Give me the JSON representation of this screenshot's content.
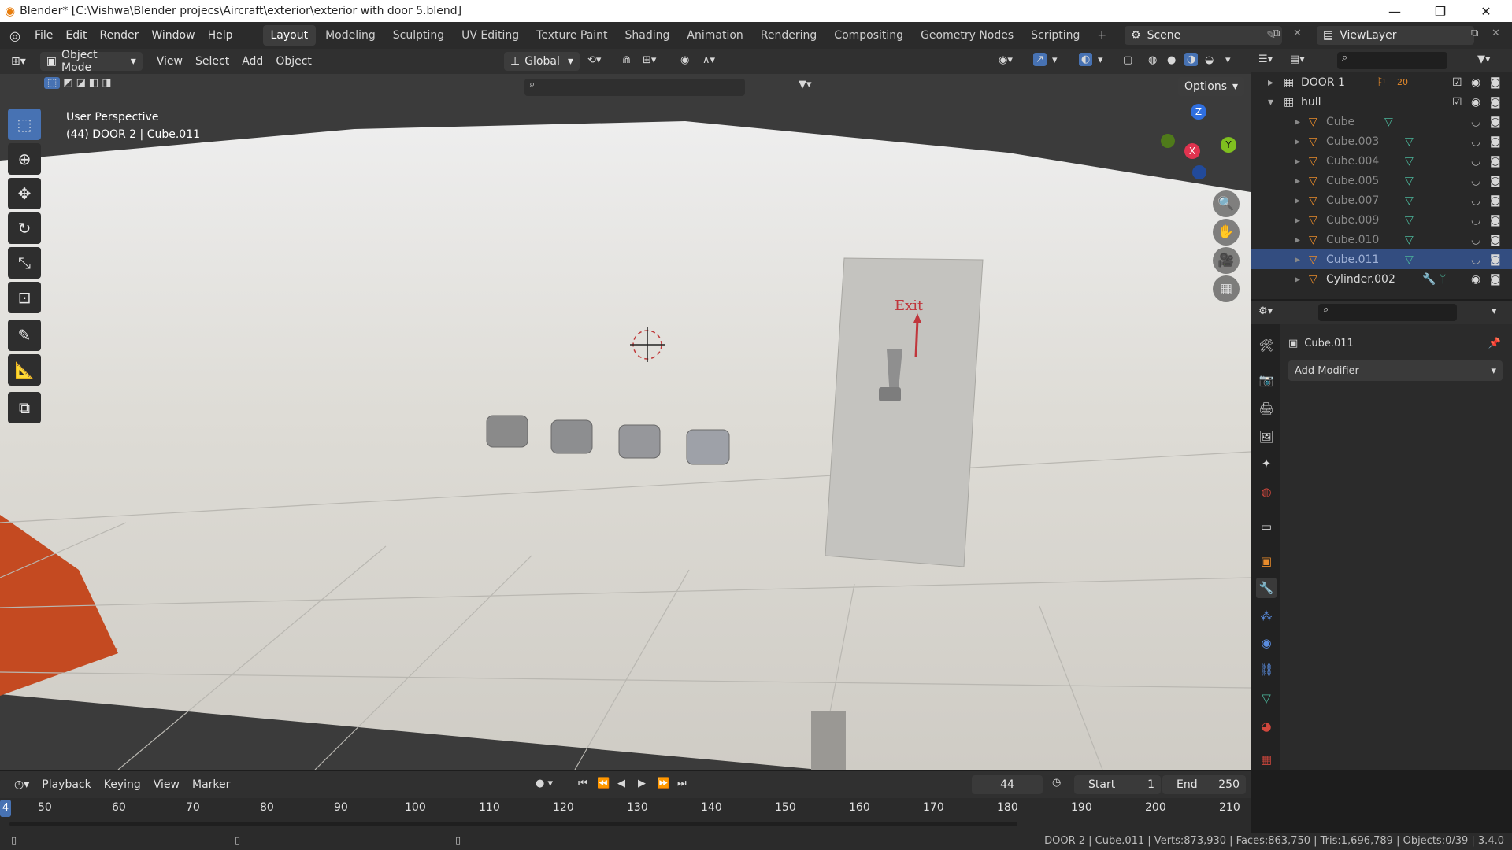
{
  "window": {
    "title": "Blender* [C:\\Vishwa\\Blender projecs\\Aircraft\\exterior\\exterior with door 5.blend]",
    "minimize": "—",
    "maximize": "❐",
    "close": "✕"
  },
  "menus": [
    "File",
    "Edit",
    "Render",
    "Window",
    "Help"
  ],
  "workspaces": [
    "Layout",
    "Modeling",
    "Sculpting",
    "UV Editing",
    "Texture Paint",
    "Shading",
    "Animation",
    "Rendering",
    "Compositing",
    "Geometry Nodes",
    "Scripting"
  ],
  "active_workspace": "Layout",
  "scene": {
    "name": "Scene",
    "view_layer": "ViewLayer"
  },
  "viewport_header": {
    "mode": "Object Mode",
    "menus": [
      "View",
      "Select",
      "Add",
      "Object"
    ],
    "orientation": "Global",
    "options": "Options"
  },
  "viewport": {
    "perspective": "User Perspective",
    "context": "(44) DOOR 2 | Cube.011",
    "door_sign": "Exit",
    "gizmo": {
      "z": "Z",
      "x": "X",
      "y": "Y"
    },
    "colors": {
      "fuselage": "#d9d7d1",
      "ground": "#3b3b3b",
      "accent": "#c44a21",
      "exit_text": "#c0363c"
    }
  },
  "outliner": {
    "items": [
      {
        "name": "DOOR 1",
        "level": 0,
        "type": "collection"
      },
      {
        "name": "hull",
        "level": 0,
        "type": "collection"
      },
      {
        "name": "Cube",
        "level": 1,
        "type": "mesh"
      },
      {
        "name": "Cube.003",
        "level": 1,
        "type": "mesh"
      },
      {
        "name": "Cube.004",
        "level": 1,
        "type": "mesh"
      },
      {
        "name": "Cube.005",
        "level": 1,
        "type": "mesh"
      },
      {
        "name": "Cube.007",
        "level": 1,
        "type": "mesh"
      },
      {
        "name": "Cube.009",
        "level": 1,
        "type": "mesh"
      },
      {
        "name": "Cube.010",
        "level": 1,
        "type": "mesh"
      },
      {
        "name": "Cube.011",
        "level": 1,
        "type": "mesh",
        "selected": true
      },
      {
        "name": "Cylinder.002",
        "level": 1,
        "type": "mesh"
      }
    ],
    "door1_count": "20"
  },
  "properties": {
    "object_name": "Cube.011",
    "add_modifier": "Add Modifier"
  },
  "timeline": {
    "menus": [
      "Playback",
      "Keying",
      "View",
      "Marker"
    ],
    "current_frame": "44",
    "start_label": "Start",
    "start": "1",
    "end_label": "End",
    "end": "250",
    "ticks": [
      "50",
      "60",
      "70",
      "80",
      "90",
      "100",
      "110",
      "120",
      "130",
      "140",
      "150",
      "160",
      "170",
      "180",
      "190",
      "200",
      "210"
    ],
    "frame_marker": "4"
  },
  "statusbar": {
    "text": "DOOR 2 | Cube.011 | Verts:873,930 | Faces:863,750 | Tris:1,696,789 | Objects:0/39 | 3.4.0"
  }
}
